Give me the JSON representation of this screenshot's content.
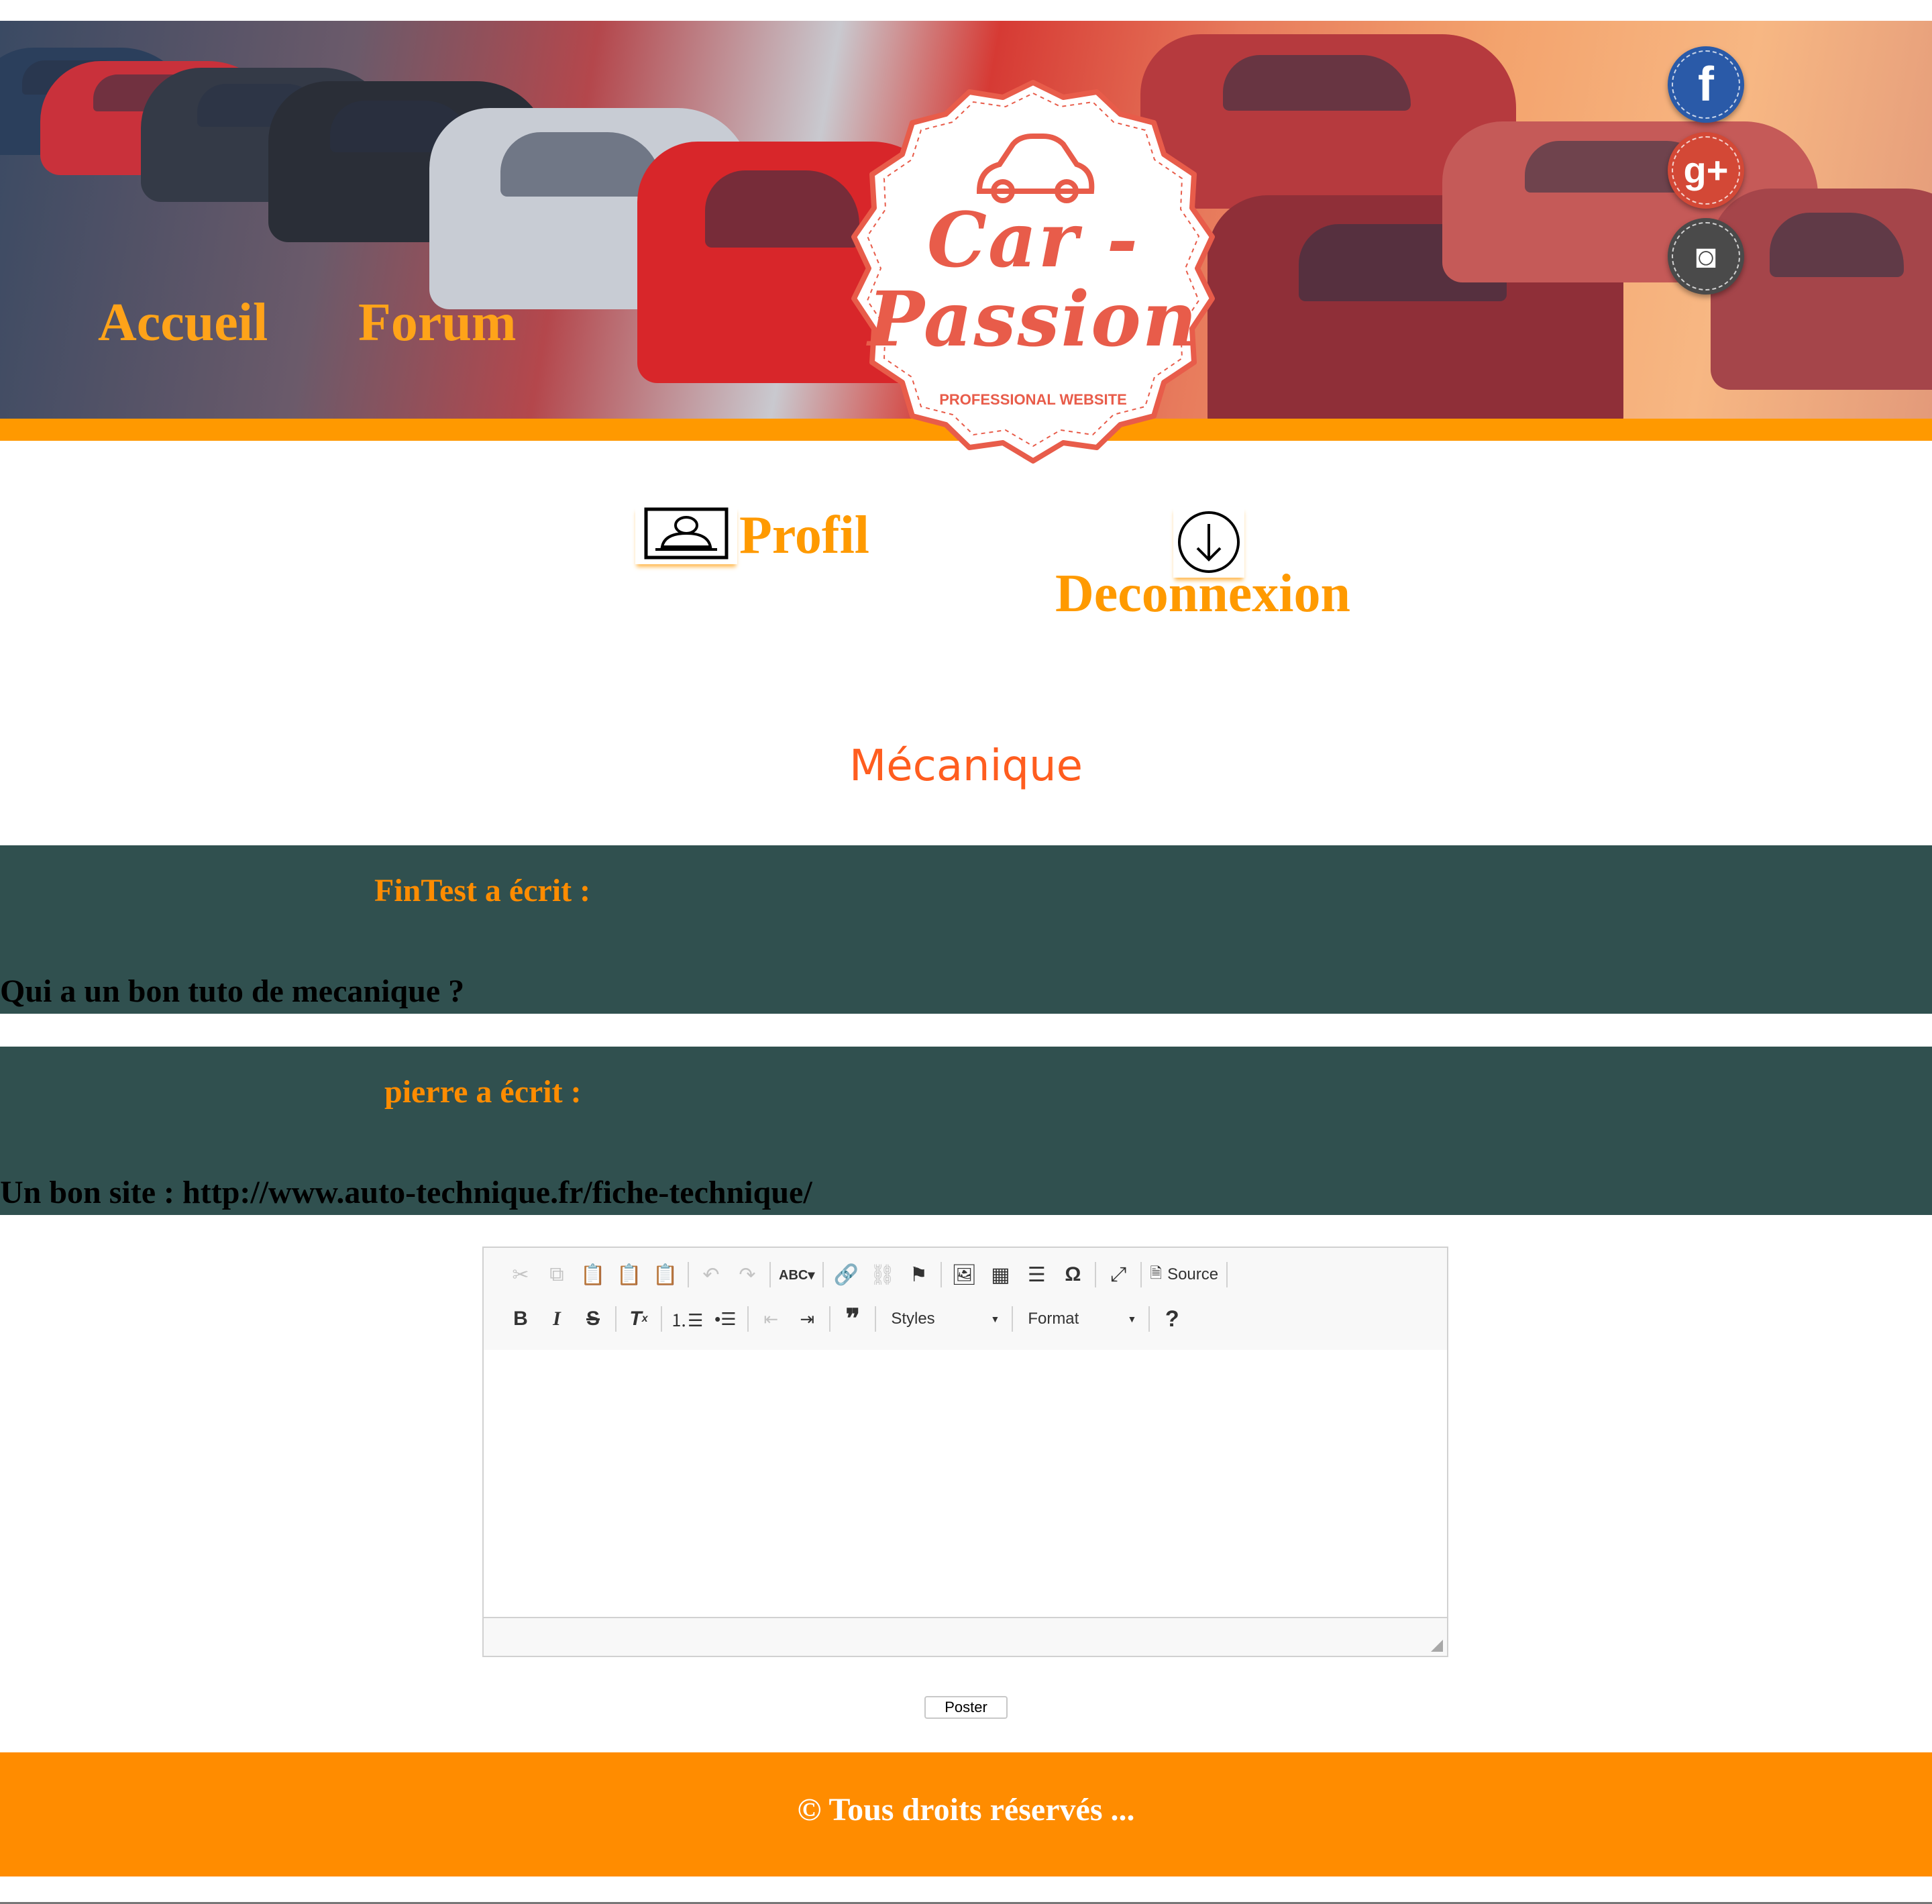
{
  "header": {
    "nav": [
      {
        "label": "Accueil"
      },
      {
        "label": "Forum"
      }
    ],
    "logo": {
      "title_line1": "Car -",
      "title_line2": "Passion",
      "subtitle": "PROFESSIONAL WEBSITE",
      "icon": "car-icon"
    },
    "social": [
      {
        "name": "facebook",
        "glyph": "f",
        "color": "#2a5aa8"
      },
      {
        "name": "google-plus",
        "glyph": "g+",
        "color": "#d34836"
      },
      {
        "name": "instagram",
        "glyph": "◙",
        "color": "#4a4a4a"
      }
    ]
  },
  "user_menu": {
    "profile_label": "Profil",
    "profile_icon": "profile-card-icon",
    "logout_label": "Deconnexion",
    "logout_icon": "download-circle-icon"
  },
  "topic": {
    "title": "Mécanique"
  },
  "posts": [
    {
      "author_line": "FinTest a écrit :",
      "text": "Qui a un bon tuto de mecanique ?"
    },
    {
      "author_line": "pierre a écrit :",
      "text": "Un bon site : http://www.auto-technique.fr/fiche-technique/"
    }
  ],
  "editor": {
    "toolbar_row1": [
      "cut",
      "copy",
      "paste",
      "paste-text",
      "paste-word",
      "undo",
      "redo",
      "spellcheck",
      "link",
      "unlink",
      "anchor",
      "image",
      "table",
      "horizontal-rule",
      "special-char",
      "maximize",
      "source"
    ],
    "source_label": "Source",
    "styles_label": "Styles",
    "format_label": "Format",
    "help_label": "?",
    "content": ""
  },
  "post_button_label": "Poster",
  "footer": {
    "text": "© Tous droits réservés ..."
  },
  "colors": {
    "accent": "#ff9900",
    "nav_text": "#ffa319",
    "post_bg": "#30504f",
    "author": "#ff8c00",
    "topic_title": "#ff5d1f",
    "logo": "#e85c4a"
  }
}
